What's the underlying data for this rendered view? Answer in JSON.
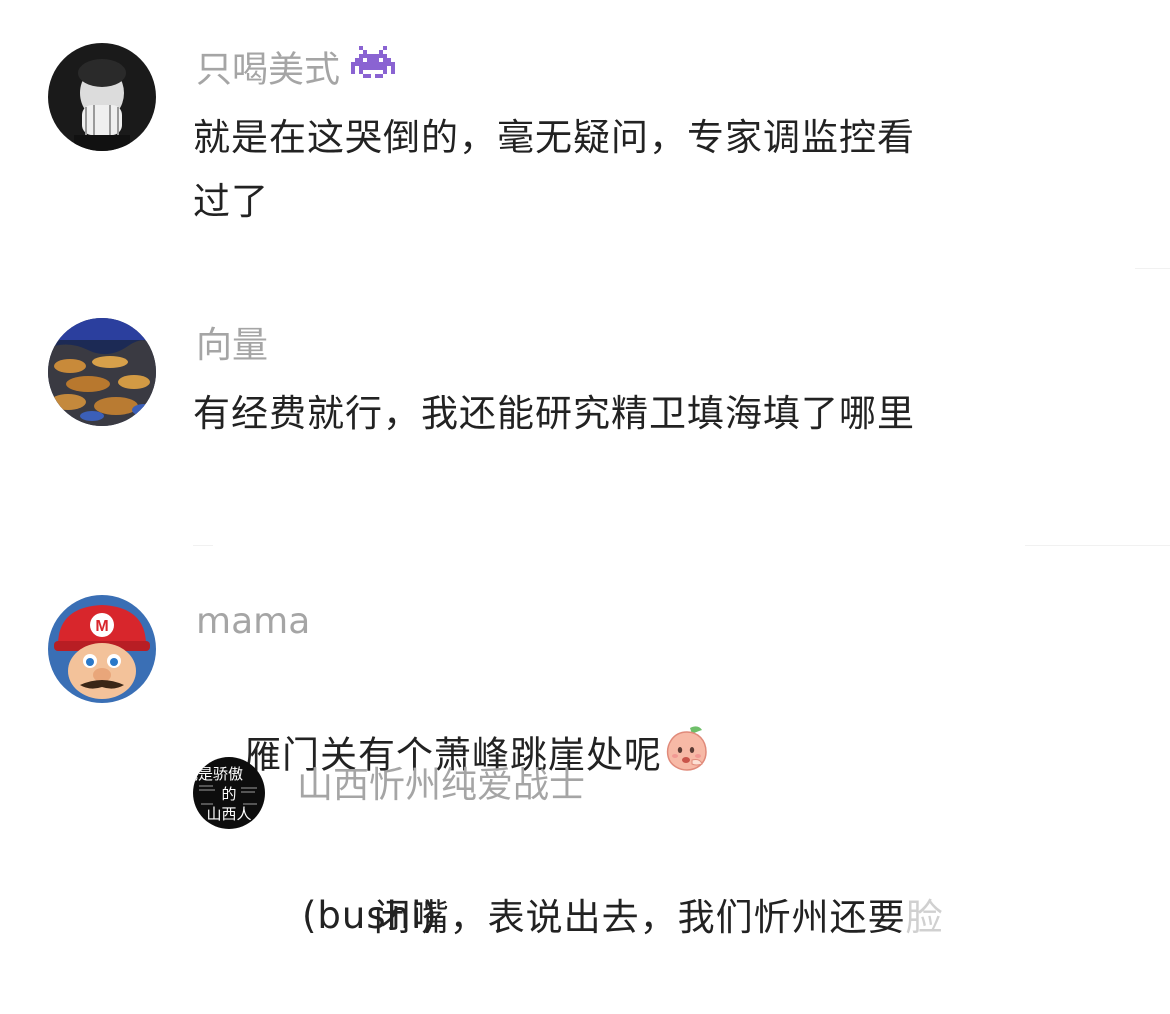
{
  "comments": [
    {
      "username": "只喝美式",
      "username_emoji": "alien-monster-icon",
      "text": "就是在这哭倒的，毫无疑问，专家调监控看\n过了"
    },
    {
      "username": "向量",
      "text": "有经费就行，我还能研究精卫填海填了哪里"
    },
    {
      "username": "mama",
      "text": "雁门关有个萧峰跳崖处呢",
      "trailing_emoji": "peach-face-icon",
      "reply": {
        "username": "山西忻州纯爱战士",
        "avatar_text_lines": [
          "我是骄傲",
          "的",
          "山西人"
        ],
        "text_line1": "闭嘴，表说出去，我们忻州还要",
        "text_line1_faded": "脸",
        "text_line2": "(bushi)"
      }
    }
  ],
  "colors": {
    "username": "#a5a5a5",
    "text": "#222222",
    "background": "#ffffff",
    "alien": "#8a63d2"
  }
}
